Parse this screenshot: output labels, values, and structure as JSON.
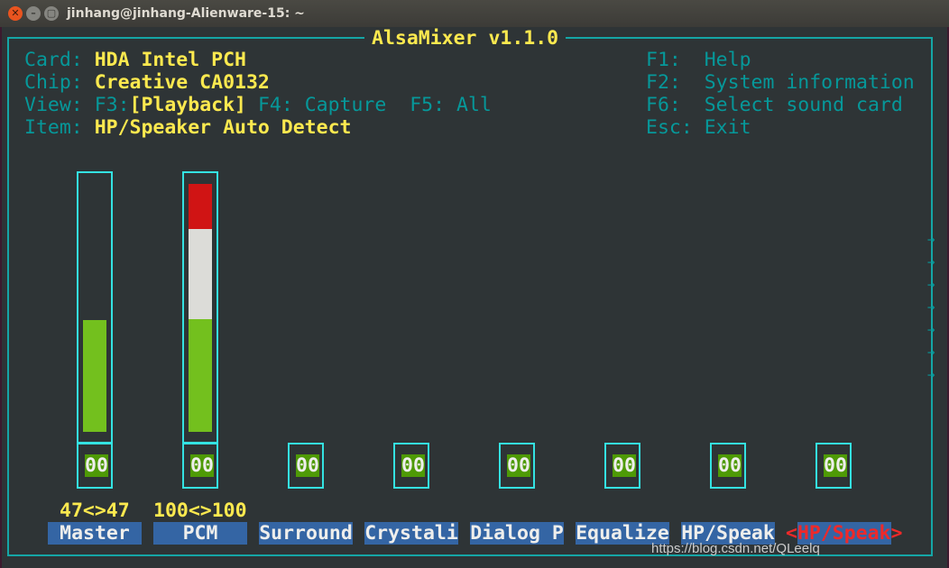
{
  "window": {
    "title": "jinhang@jinhang-Alienware-15: ~"
  },
  "app": {
    "title": "AlsaMixer v1.1.0"
  },
  "info": {
    "card_label": "Card:",
    "card": "HDA Intel PCH",
    "chip_label": "Chip:",
    "chip": "Creative CA0132",
    "view_label": "View:",
    "view_f3": "F3:",
    "view_playback": "[Playback]",
    "view_f4": "F4: Capture",
    "view_f5": "F5: All",
    "item_label": "Item:",
    "item": "HP/Speaker Auto Detect"
  },
  "keys": [
    {
      "key": "F1:",
      "action": "Help"
    },
    {
      "key": "F2:",
      "action": "System information"
    },
    {
      "key": "F6:",
      "action": "Select sound card"
    },
    {
      "key": "Esc:",
      "action": "Exit"
    }
  ],
  "controls": [
    {
      "name": "Master",
      "value_text": "47<>47",
      "level": 47,
      "mute": "00"
    },
    {
      "name": "PCM",
      "value_text": "100<>100",
      "level": 100,
      "mute": "00"
    },
    {
      "name": "Surround",
      "mute": "00"
    },
    {
      "name": "Crystali",
      "mute": "00"
    },
    {
      "name": "Dialog P",
      "mute": "00"
    },
    {
      "name": "Equalize",
      "mute": "00"
    },
    {
      "name": "HP/Speak",
      "mute": "00"
    },
    {
      "name": "HP/Speak",
      "mute": "00",
      "selected": true
    }
  ],
  "colors": {
    "border": "#15a6a6",
    "label": "#06989a",
    "value": "#fce94f",
    "bar_green": "#73c01e",
    "bar_white": "#dcdcd8",
    "bar_red": "#d01414",
    "selected": "#ef2929"
  },
  "watermark": "https://blog.csdn.net/QLeelq"
}
